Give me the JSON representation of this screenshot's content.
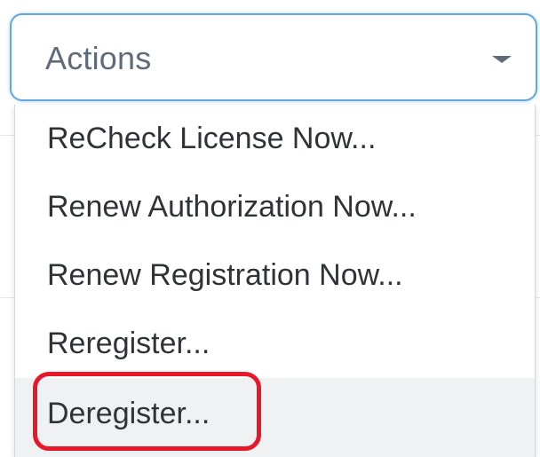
{
  "actions_dropdown": {
    "label": "Actions",
    "caret_icon": "caret-down-icon"
  },
  "menu": {
    "items": [
      {
        "label": "ReCheck License Now...",
        "highlighted": false
      },
      {
        "label": "Renew Authorization Now...",
        "highlighted": false
      },
      {
        "label": "Renew Registration Now...",
        "highlighted": false
      },
      {
        "label": "Reregister...",
        "highlighted": false
      },
      {
        "label": "Deregister...",
        "highlighted": true
      }
    ]
  },
  "colors": {
    "select_border": "#62a8e0",
    "annotation_border": "#e8182a",
    "text": "#2f3338",
    "label_text": "#5f6b7a",
    "hover_background": "#f0f1f3"
  }
}
